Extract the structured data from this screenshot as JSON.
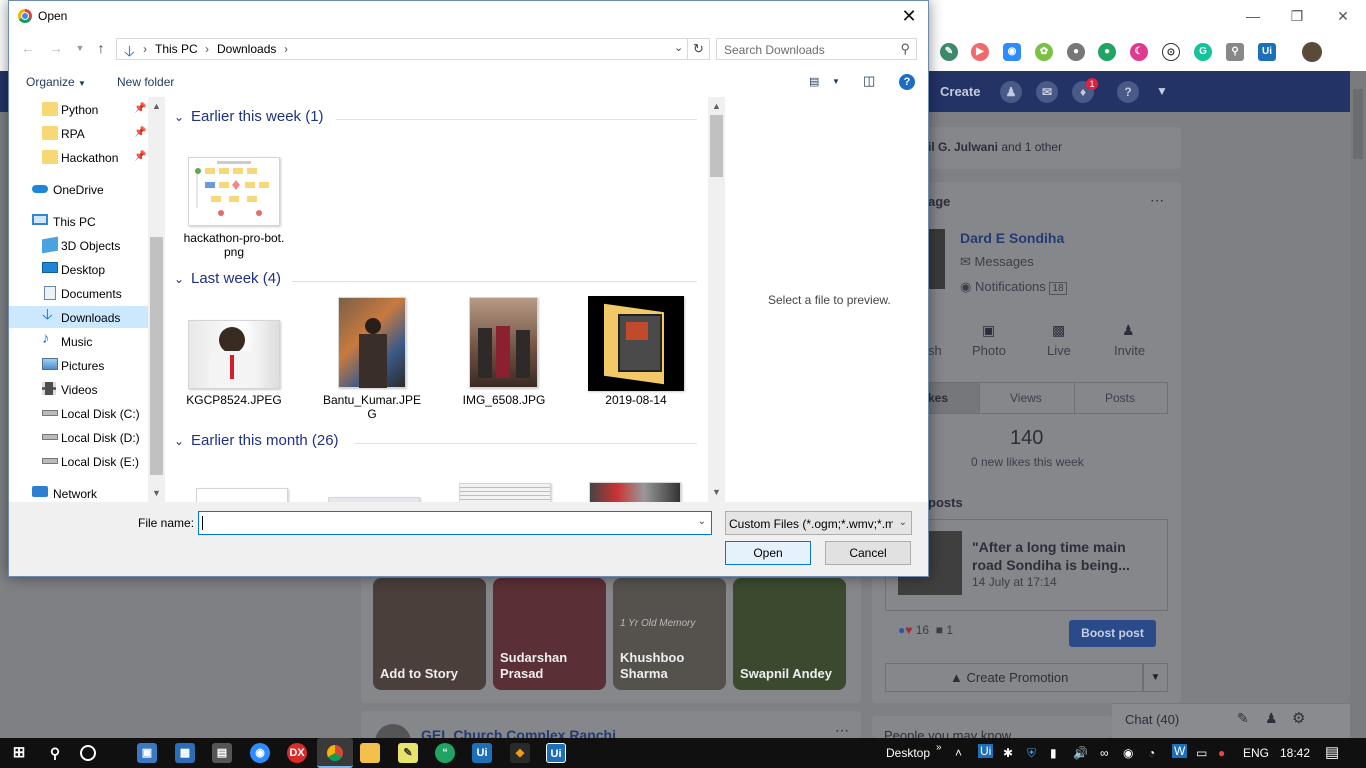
{
  "browser_background": {
    "fb_nav": {
      "create_label": "Create",
      "notif_count": "1"
    },
    "activity": {
      "text_name": "il G. Julwani",
      "text_rest": "and 1 other"
    },
    "page_card": {
      "heading_fragment": "age",
      "page_name": "Dard E Sondiha",
      "messages_label": "Messages",
      "notifications_label": "Notifications",
      "notifications_count": "18",
      "actions": [
        "sh",
        "Photo",
        "Live",
        "Invite"
      ],
      "tabs": [
        "kes",
        "Views",
        "Posts"
      ],
      "likes_count": "140",
      "likes_sub": "0 new likes this week"
    },
    "posts_card": {
      "heading_fragment": "posts",
      "post_title": "\"After a long time main road Sondiha is being...",
      "post_date": "14 July at 17:14",
      "reactions": "16",
      "comments": "1",
      "boost_label": "Boost post",
      "promo_label": "Create Promotion"
    },
    "stories": [
      {
        "label": "Add to Story"
      },
      {
        "label": "Sudarshan Prasad"
      },
      {
        "label": "Khushboo Sharma",
        "overlay": "1 Yr Old Memory"
      },
      {
        "label": "Swapnil Andey"
      }
    ],
    "feed_title": "GEL Church Complex Ranchi",
    "people_you_may_know": "People you may know",
    "chat_label": "Chat (40)"
  },
  "dialog": {
    "title": "Open",
    "address": {
      "segments": [
        "This PC",
        "Downloads"
      ]
    },
    "search_placeholder": "Search Downloads",
    "toolbar": {
      "organize": "Organize",
      "new_folder": "New folder"
    },
    "nav_items": [
      {
        "label": "Python",
        "icon": "folder-icon",
        "pinned": true
      },
      {
        "label": "RPA",
        "icon": "folder-icon",
        "pinned": true
      },
      {
        "label": "Hackathon",
        "icon": "folder-icon",
        "pinned": true
      },
      {
        "label": "OneDrive",
        "icon": "cloud-icon"
      },
      {
        "label": "This PC",
        "icon": "computer-icon"
      },
      {
        "label": "3D Objects",
        "icon": "cube-icon"
      },
      {
        "label": "Desktop",
        "icon": "desktop-icon"
      },
      {
        "label": "Documents",
        "icon": "documents-icon"
      },
      {
        "label": "Downloads",
        "icon": "download-icon",
        "selected": true
      },
      {
        "label": "Music",
        "icon": "music-icon"
      },
      {
        "label": "Pictures",
        "icon": "pictures-icon"
      },
      {
        "label": "Videos",
        "icon": "videos-icon"
      },
      {
        "label": "Local Disk (C:)",
        "icon": "drive-icon"
      },
      {
        "label": "Local Disk (D:)",
        "icon": "drive-icon"
      },
      {
        "label": "Local Disk (E:)",
        "icon": "drive-icon"
      },
      {
        "label": "Network",
        "icon": "network-icon"
      }
    ],
    "groups": [
      {
        "label": "Earlier this week (1)",
        "files": [
          {
            "name": "hackathon-pro-bot.png"
          }
        ]
      },
      {
        "label": "Last week (4)",
        "files": [
          {
            "name": "KGCP8524.JPEG"
          },
          {
            "name": "Bantu_Kumar.JPEG"
          },
          {
            "name": "IMG_6508.JPG"
          },
          {
            "name": "2019-08-14"
          }
        ]
      },
      {
        "label": "Earlier this month (26)",
        "files": []
      }
    ],
    "preview_text": "Select a file to preview.",
    "file_name_label": "File name:",
    "file_name_value": "",
    "file_type": "Custom Files (*.ogm;*.wmv;*.m",
    "open_label": "Open",
    "cancel_label": "Cancel"
  },
  "taskbar": {
    "desktop_label": "Desktop",
    "lang": "ENG",
    "time": "18:42"
  }
}
